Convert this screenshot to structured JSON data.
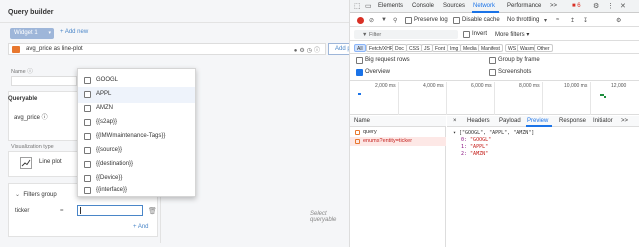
{
  "query_builder": {
    "title": "Query builder",
    "widget_tab": "Widget 1",
    "add_new": "+ Add new",
    "plot_name": "avg_price as line-plot",
    "add_plot": "Add pl",
    "name_label": "Name ⓘ",
    "queryable_title": "Queryable",
    "queryable_field": "avg_price ⓘ",
    "viz_label": "Visualization type",
    "viz_value": "Line plot",
    "filters_title": "Filters group",
    "filter_field": "ticker",
    "filter_op": "=",
    "filter_value": "",
    "add_and": "+ And",
    "select_hint": "Select queryable",
    "dropdown_options": [
      {
        "label": "GOOGL",
        "highlighted": false
      },
      {
        "label": "APPL",
        "highlighted": true
      },
      {
        "label": "AMZN",
        "highlighted": false
      },
      {
        "label": "{{s2ap}}",
        "highlighted": false
      },
      {
        "label": "{{IMWmaintenance-Tags}}",
        "highlighted": false
      },
      {
        "label": "{{source}}",
        "highlighted": false
      },
      {
        "label": "{{destination}}",
        "highlighted": false
      },
      {
        "label": "{{Device}}",
        "highlighted": false
      },
      {
        "label": "{{interface}}",
        "highlighted": false
      }
    ]
  },
  "devtools": {
    "tabs": [
      "Elements",
      "Console",
      "Sources",
      "Network",
      "Performance",
      ">>"
    ],
    "active_tab": "Network",
    "badge": "■ 6",
    "toolbar": {
      "preserve_log": "Preserve log",
      "disable_cache": "Disable cache",
      "throttling": "No throttling"
    },
    "filter_placeholder": "Filter",
    "invert": "Invert",
    "more_filters": "More filters ▾",
    "types": [
      "All",
      "Fetch/XHR",
      "Doc",
      "CSS",
      "JS",
      "Font",
      "Img",
      "Media",
      "Manifest",
      "WS",
      "Wasm",
      "Other"
    ],
    "active_type": "All",
    "big_request_rows": "Big request rows",
    "group_by_frame": "Group by frame",
    "overview": "Overview",
    "screenshots": "Screenshots",
    "timeline_labels": [
      "2,000 ms",
      "4,000 ms",
      "6,000 ms",
      "8,000 ms",
      "10,000 ms",
      "12,000"
    ],
    "name_header": "Name",
    "requests": [
      {
        "name": "query",
        "selected": false
      },
      {
        "name": "enums?entity=ticker",
        "selected": true
      }
    ],
    "detail_tabs": [
      "×",
      "Headers",
      "Payload",
      "Preview",
      "Response",
      "Initiator",
      ">>"
    ],
    "active_detail_tab": "Preview",
    "preview": {
      "summary": "▾ [\"GOOGL\", \"APPL\", \"AMZN\"]",
      "items": [
        {
          "key": "0:",
          "value": "\"GOOGL\""
        },
        {
          "key": "1:",
          "value": "\"APPL\""
        },
        {
          "key": "2:",
          "value": "\"AMZN\""
        }
      ]
    }
  }
}
